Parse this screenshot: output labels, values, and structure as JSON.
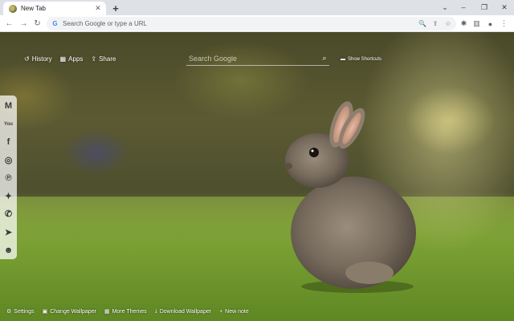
{
  "tab": {
    "title": "New Tab",
    "close": "✕"
  },
  "newtab": "+",
  "window_controls": {
    "chevron": "⌄",
    "minimize": "–",
    "restore": "❐",
    "close": "✕"
  },
  "nav": {
    "back": "←",
    "forward": "→",
    "reload": "↻"
  },
  "omnibox": {
    "placeholder": "Search Google or type a URL"
  },
  "toolbar_icons": {
    "zoom": "🔍",
    "share": "⇪",
    "bookmark": "☆",
    "extensions": "✱",
    "sidepanel": "▥",
    "profile": "●",
    "menu": "⋮"
  },
  "top_links": [
    {
      "icon": "↺",
      "label": "History"
    },
    {
      "icon": "▦",
      "label": "Apps"
    },
    {
      "icon": "⇪",
      "label": "Share"
    }
  ],
  "search": {
    "placeholder": "Search Google",
    "icon": "⌕"
  },
  "show_shortcuts": {
    "icon": "▬",
    "label": "Show Shortcuts"
  },
  "social": [
    {
      "name": "gmail",
      "glyph": "M"
    },
    {
      "name": "youtube",
      "glyph": "You"
    },
    {
      "name": "facebook",
      "glyph": "f"
    },
    {
      "name": "instagram",
      "glyph": "◎"
    },
    {
      "name": "pinterest",
      "glyph": "℗"
    },
    {
      "name": "twitter",
      "glyph": "✦"
    },
    {
      "name": "whatsapp",
      "glyph": "✆"
    },
    {
      "name": "telegram",
      "glyph": "➤"
    },
    {
      "name": "reddit",
      "glyph": "☻"
    }
  ],
  "bottom": [
    {
      "icon": "⚙",
      "label": "Settings"
    },
    {
      "icon": "▣",
      "label": "Change Wallpaper"
    },
    {
      "icon": "▦",
      "label": "More Themes"
    },
    {
      "icon": "⤓",
      "label": "Download Wallpaper"
    },
    {
      "icon": "+",
      "label": "New note"
    }
  ]
}
